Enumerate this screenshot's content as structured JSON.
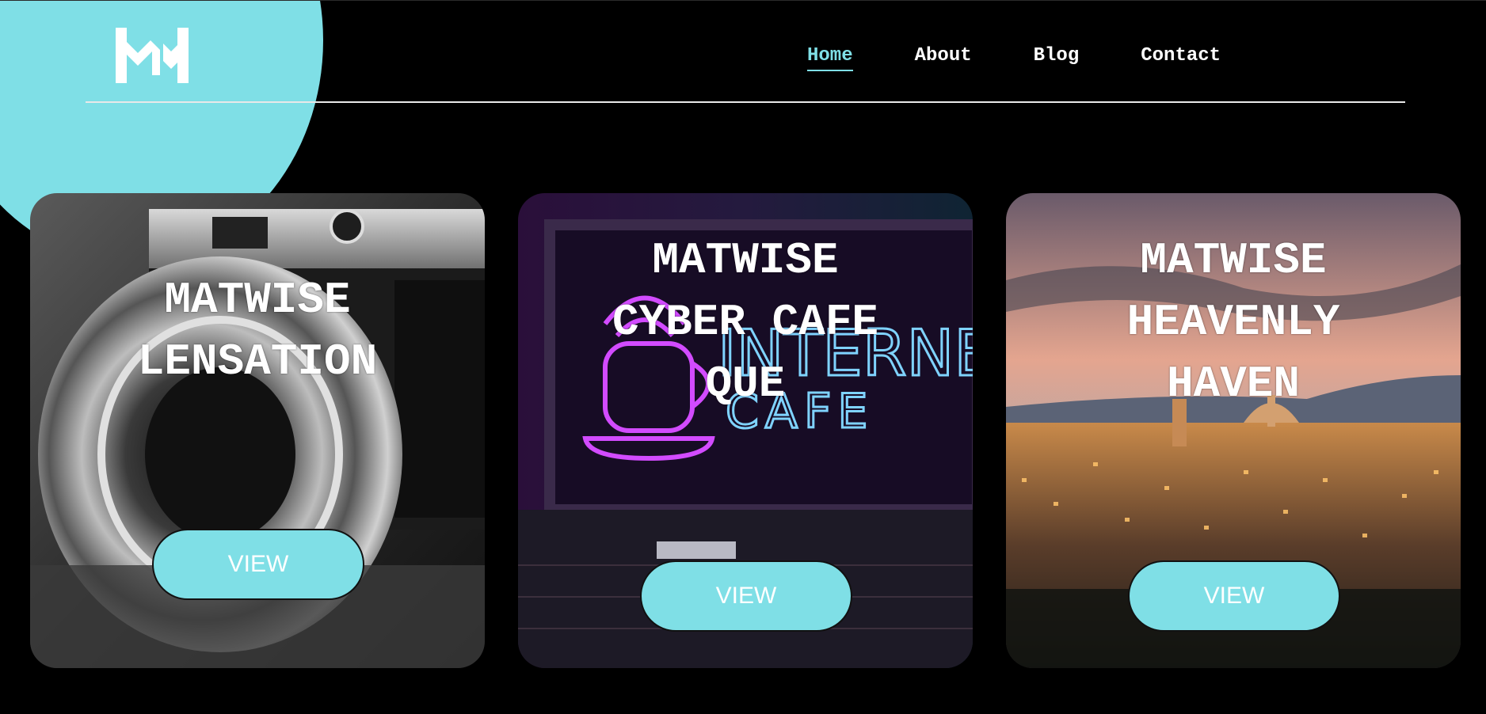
{
  "logo": {
    "icon": "mw-logo-icon"
  },
  "nav": {
    "items": [
      {
        "label": "Home",
        "active": true
      },
      {
        "label": "About",
        "active": false
      },
      {
        "label": "Blog",
        "active": false
      },
      {
        "label": "Contact",
        "active": false
      }
    ]
  },
  "cards": [
    {
      "title": "MATWISE\nLENSATION",
      "button": "VIEW",
      "image": "vintage-camera-image"
    },
    {
      "title": "MATWISE\nCYBER CAFE\nQUE",
      "button": "VIEW",
      "image": "neon-internet-cafe-image",
      "image_text": [
        "INTERNET",
        "CAFE"
      ]
    },
    {
      "title": "MATWISE\nHEAVENLY\nHAVEN",
      "button": "VIEW",
      "image": "city-sunset-image"
    }
  ],
  "colors": {
    "accent": "#7fdfe6",
    "background": "#000000",
    "text": "#ffffff"
  }
}
